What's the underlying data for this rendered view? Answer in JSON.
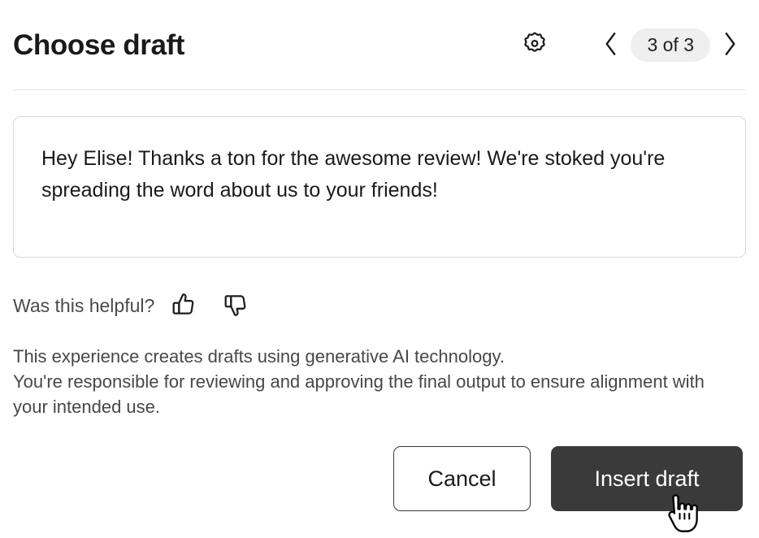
{
  "header": {
    "title": "Choose draft",
    "settings_icon": "gear-icon",
    "prev_icon": "chevron-left-icon",
    "next_icon": "chevron-right-icon",
    "counter": "3 of 3",
    "current_index": 3,
    "total": 3
  },
  "draft": {
    "text": "Hey Elise! Thanks a ton for the awesome review! We're stoked you're spreading the word about us to your friends!"
  },
  "feedback": {
    "label": "Was this helpful?",
    "thumbs_up_icon": "thumbs-up-icon",
    "thumbs_down_icon": "thumbs-down-icon"
  },
  "disclaimer": {
    "line1": "This experience creates drafts using generative AI technology.",
    "line2": "You're responsible for reviewing and approving the final output to ensure alignment with your intended use."
  },
  "footer": {
    "cancel_label": "Cancel",
    "insert_label": "Insert draft"
  },
  "cursor": {
    "type": "pointer-hand-cursor"
  },
  "colors": {
    "primary_button_bg": "#3a3a3a",
    "pill_bg": "#efefef",
    "border": "#d7d7d7",
    "divider": "#e6e6e6",
    "body_text": "#474747",
    "title_text": "#1a1a1a"
  }
}
